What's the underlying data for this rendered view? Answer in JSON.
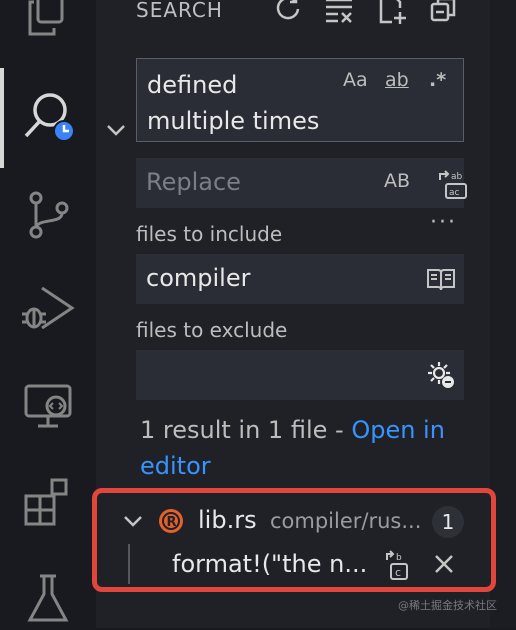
{
  "activity_bar": {
    "items": [
      {
        "name": "explorer"
      },
      {
        "name": "search",
        "active": true
      },
      {
        "name": "source-control"
      },
      {
        "name": "run-and-debug"
      },
      {
        "name": "remote-explorer"
      },
      {
        "name": "extensions"
      },
      {
        "name": "testing"
      }
    ]
  },
  "search_panel": {
    "title": "SEARCH",
    "toolbar": [
      "refresh-icon",
      "clear-results-icon",
      "new-search-editor-icon",
      "collapse-all-icon"
    ],
    "query": "defined multiple times",
    "options": {
      "match_case": "Aa",
      "whole_word": "ab",
      "regex": ".*"
    },
    "replace": {
      "placeholder": "Replace",
      "preserve_case": "AB"
    },
    "more_label": "···",
    "include": {
      "label": "files to include",
      "value": "compiler"
    },
    "exclude": {
      "label": "files to exclude",
      "value": ""
    },
    "result_summary": "1 result in 1 file - ",
    "open_in_editor": "Open in editor"
  },
  "results": [
    {
      "file": "lib.rs",
      "path": "compiler/rus...",
      "count": "1",
      "matches": [
        "format!(\"the n..."
      ]
    }
  ],
  "watermark": "@稀土掘金技术社区",
  "colors": {
    "background": "#181a1f",
    "sidebar": "#1f2127",
    "input": "#2a2d35",
    "link": "#3794ff",
    "highlight": "#e2453c",
    "rust": "#e3612b"
  }
}
